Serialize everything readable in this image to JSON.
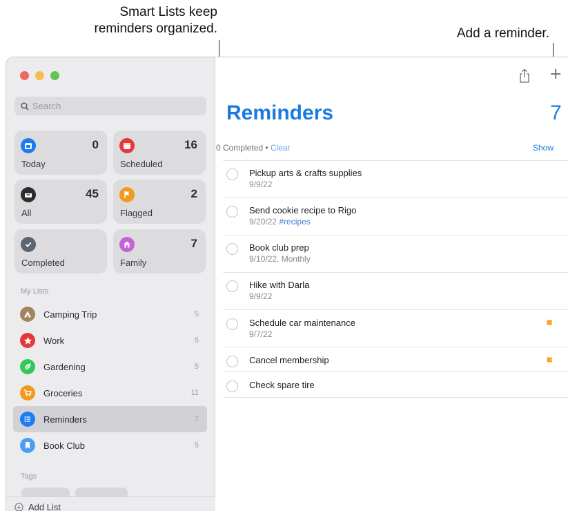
{
  "callouts": {
    "left_line1": "Smart Lists keep",
    "left_line2": "reminders organized.",
    "right": "Add a reminder."
  },
  "search": {
    "placeholder": "Search"
  },
  "smart_lists": [
    {
      "label": "Today",
      "count": "0",
      "color": "#1e7cf2",
      "icon": "calendar-today-icon"
    },
    {
      "label": "Scheduled",
      "count": "16",
      "color": "#e5383b",
      "icon": "calendar-icon"
    },
    {
      "label": "All",
      "count": "45",
      "color": "#2c2c2e",
      "icon": "tray-icon"
    },
    {
      "label": "Flagged",
      "count": "2",
      "color": "#f29a1b",
      "icon": "flag-icon"
    },
    {
      "label": "Completed",
      "count": "",
      "color": "#5b6670",
      "icon": "checkmark-icon"
    },
    {
      "label": "Family",
      "count": "7",
      "color": "#c562d8",
      "icon": "house-icon"
    }
  ],
  "my_lists": {
    "heading": "My Lists",
    "items": [
      {
        "name": "Camping Trip",
        "count": "5",
        "color": "#a2845e",
        "icon": "tent-icon"
      },
      {
        "name": "Work",
        "count": "5",
        "color": "#e5383b",
        "icon": "star-icon"
      },
      {
        "name": "Gardening",
        "count": "5",
        "color": "#34c759",
        "icon": "leaf-icon"
      },
      {
        "name": "Groceries",
        "count": "11",
        "color": "#f29a1b",
        "icon": "cart-icon"
      },
      {
        "name": "Reminders",
        "count": "7",
        "color": "#1e7cf2",
        "icon": "list-bullet-icon"
      },
      {
        "name": "Book Club",
        "count": "5",
        "color": "#4a9ff5",
        "icon": "bookmark-icon"
      }
    ]
  },
  "tags": {
    "heading": "Tags"
  },
  "footer": {
    "add_list": "Add List"
  },
  "main": {
    "title": "Reminders",
    "count": "7",
    "completed_text": "0 Completed",
    "separator": " • ",
    "clear_label": "Clear",
    "show_label": "Show",
    "reminders": [
      {
        "title": "Pickup arts & crafts supplies",
        "date": "9/9/22",
        "tag": "",
        "flagged": false
      },
      {
        "title": "Send cookie recipe to Rigo",
        "date": "9/20/22",
        "tag": "#recipes",
        "flagged": false
      },
      {
        "title": "Book club prep",
        "date": "9/10/22, Monthly",
        "tag": "",
        "flagged": false
      },
      {
        "title": "Hike with Darla",
        "date": "9/9/22",
        "tag": "",
        "flagged": false
      },
      {
        "title": "Schedule car maintenance",
        "date": "9/7/22",
        "tag": "",
        "flagged": true
      },
      {
        "title": "Cancel membership",
        "date": "",
        "tag": "",
        "flagged": true
      },
      {
        "title": "Check spare tire",
        "date": "",
        "tag": "",
        "flagged": false
      }
    ]
  },
  "colors": {
    "accent": "#1c7ae0",
    "flag": "#f5a623"
  }
}
